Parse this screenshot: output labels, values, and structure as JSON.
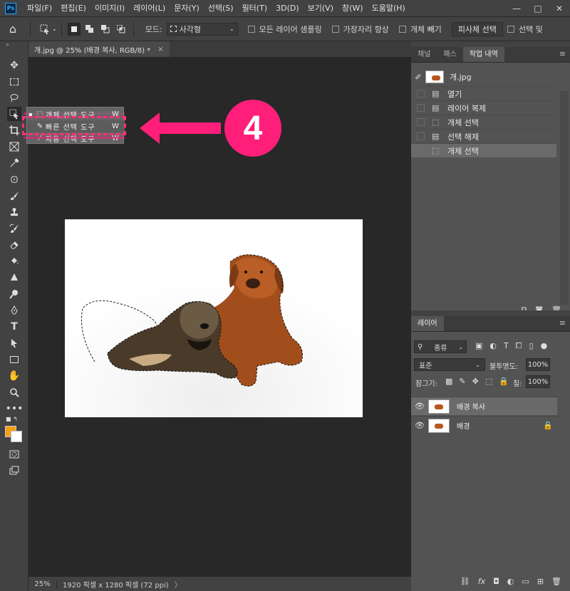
{
  "menubar": {
    "logo": "Ps",
    "items": [
      "파일(F)",
      "편집(E)",
      "이미지(I)",
      "레이어(L)",
      "문자(Y)",
      "선택(S)",
      "필터(T)",
      "3D(D)",
      "보기(V)",
      "창(W)",
      "도움말(H)"
    ],
    "window_buttons": [
      "—",
      "□",
      "✕"
    ]
  },
  "optionsbar": {
    "mode_label": "모드:",
    "mode_value": "사각형",
    "sample_all_layers": "모든 레이어 샘플링",
    "enhance_edge": "가장자리 향상",
    "subtract_object": "개체 빼기",
    "select_subject": "피사체 선택",
    "select_mask": "선택 및"
  },
  "document": {
    "tab_title": "개.jpg @ 25% (배경 복사, RGB/8) *",
    "tab_close": "×",
    "zoom": "25%",
    "doc_info": "1920 픽셀 x 1280 픽셀 (72 ppi)",
    "status_arrow": "〉"
  },
  "flyout": {
    "items": [
      {
        "bullet": "▪",
        "name": "개체 선택 도구",
        "key": "W"
      },
      {
        "bullet": "",
        "name": "빠른 선택 도구",
        "key": "W"
      },
      {
        "bullet": "",
        "name": "자동 선택 도구",
        "key": "W"
      }
    ]
  },
  "annotation": {
    "step_number": "4",
    "accent": "#ff1f7a"
  },
  "right_top": {
    "tabs": [
      "채널",
      "패스",
      "작업 내역"
    ],
    "active_tab": "작업 내역",
    "snapshot_name": "개.jpg",
    "history": [
      "열기",
      "레이어 복제",
      "개체 선택",
      "선택 해제",
      "개체 선택"
    ]
  },
  "layers_panel": {
    "tab": "레이어",
    "filter_kind": "종류",
    "blend_mode": "표준",
    "opacity_label": "불투명도:",
    "opacity_value": "100%",
    "lock_label": "잠그기:",
    "fill_label": "칠:",
    "fill_value": "100%",
    "layers": [
      {
        "name": "배경 복사",
        "selected": true
      },
      {
        "name": "배경",
        "selected": false
      }
    ]
  },
  "colors": {
    "foreground": "#f5a014",
    "background": "#ffffff",
    "ui_dark": "#282828"
  }
}
